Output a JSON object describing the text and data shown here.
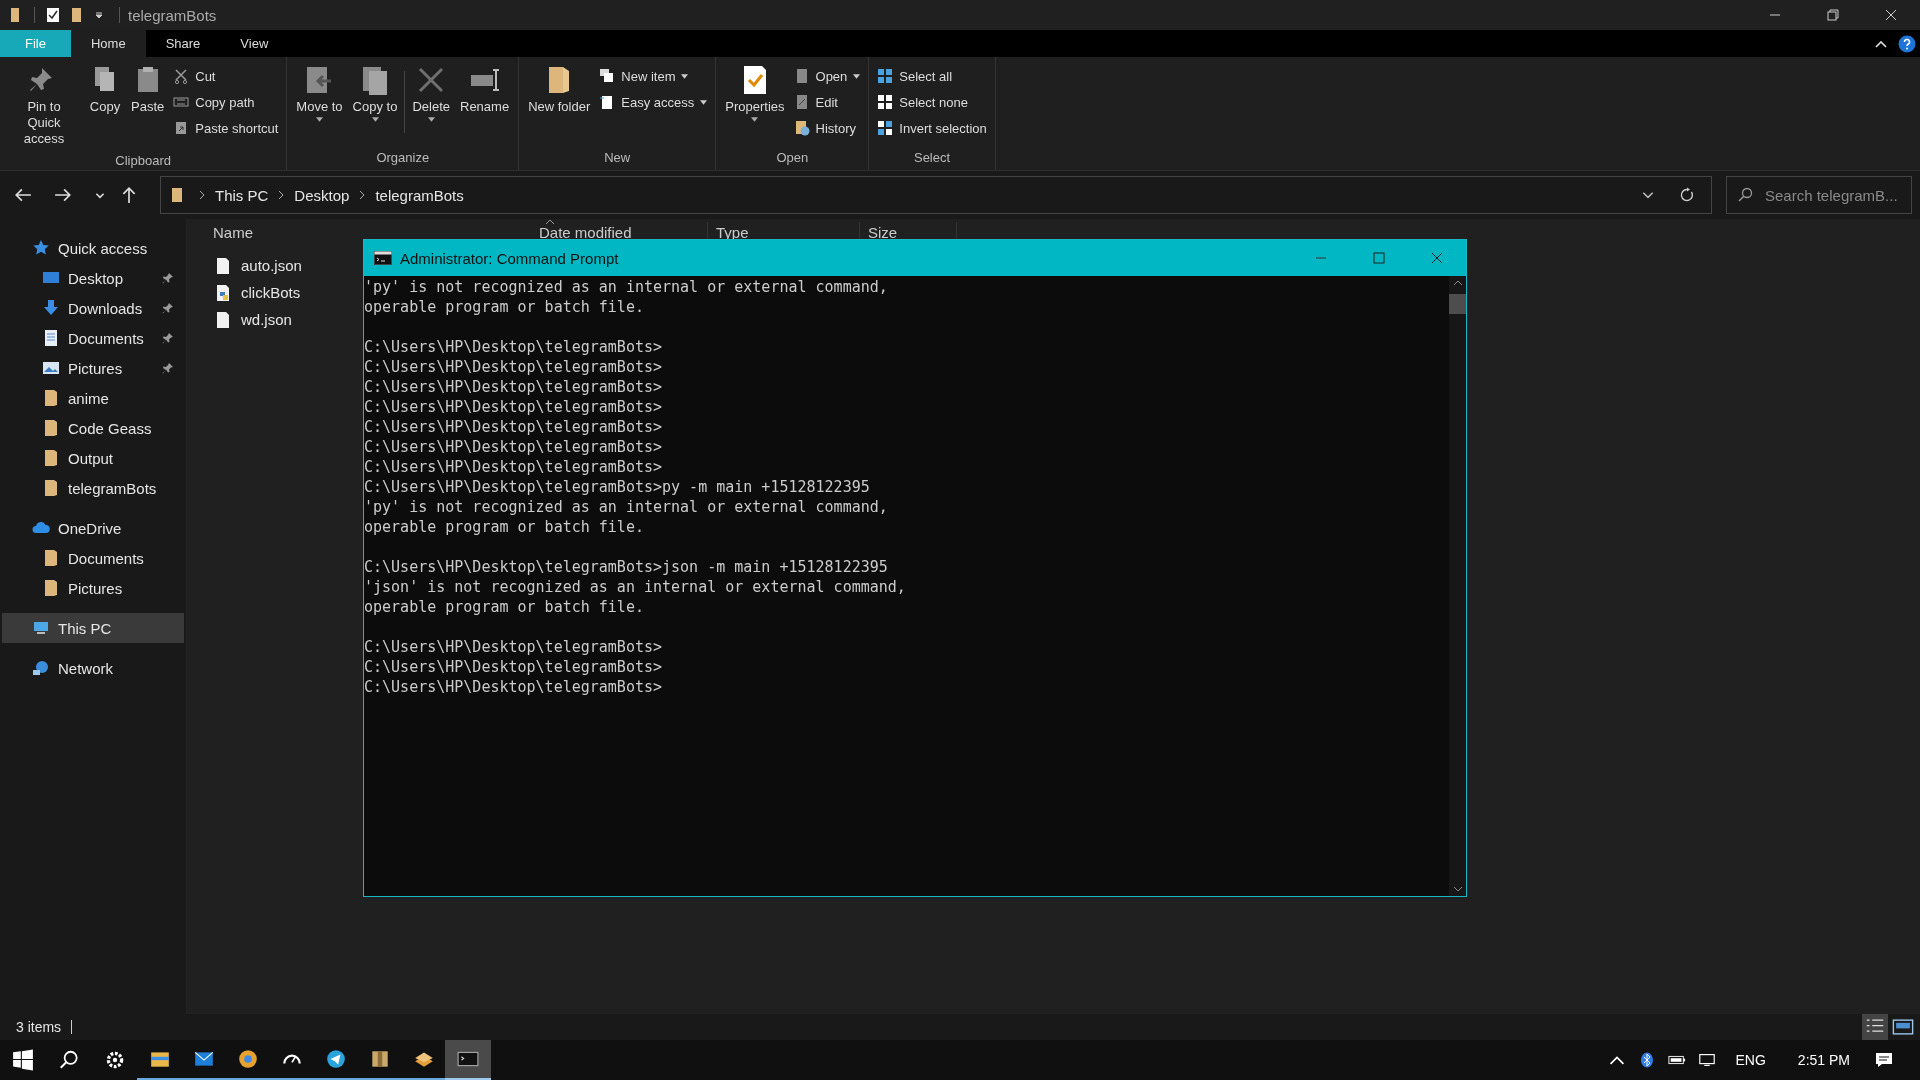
{
  "window": {
    "title": "telegramBots"
  },
  "ribbon": {
    "tabs": [
      {
        "label": "File",
        "selected": false,
        "kind": "file"
      },
      {
        "label": "Home",
        "selected": true,
        "kind": "tab"
      },
      {
        "label": "Share",
        "selected": false,
        "kind": "tab"
      },
      {
        "label": "View",
        "selected": false,
        "kind": "tab"
      }
    ],
    "groups": [
      {
        "label": "Clipboard",
        "items": [
          {
            "label": "Pin to Quick access",
            "kind": "large",
            "dropdown": false
          },
          {
            "label": "Copy",
            "kind": "large",
            "dropdown": false
          },
          {
            "label": "Paste",
            "kind": "large",
            "dropdown": false
          },
          {
            "label": "Cut",
            "kind": "small",
            "dropdown": false
          },
          {
            "label": "Copy path",
            "kind": "small",
            "dropdown": false
          },
          {
            "label": "Paste shortcut",
            "kind": "small",
            "dropdown": false
          }
        ]
      },
      {
        "label": "Organize",
        "items": [
          {
            "label": "Move to",
            "kind": "large",
            "dropdown": true
          },
          {
            "label": "Copy to",
            "kind": "large",
            "dropdown": true
          },
          {
            "label": "Delete",
            "kind": "large",
            "dropdown": true
          },
          {
            "label": "Rename",
            "kind": "large",
            "dropdown": false
          }
        ]
      },
      {
        "label": "New",
        "items": [
          {
            "label": "New folder",
            "kind": "large",
            "dropdown": false
          },
          {
            "label": "New item",
            "kind": "small",
            "dropdown": true
          },
          {
            "label": "Easy access",
            "kind": "small",
            "dropdown": true
          }
        ]
      },
      {
        "label": "Open",
        "items": [
          {
            "label": "Properties",
            "kind": "large",
            "dropdown": true
          },
          {
            "label": "Open",
            "kind": "small",
            "dropdown": true
          },
          {
            "label": "Edit",
            "kind": "small",
            "dropdown": false
          },
          {
            "label": "History",
            "kind": "small",
            "dropdown": false
          }
        ]
      },
      {
        "label": "Select",
        "items": [
          {
            "label": "Select all",
            "kind": "small",
            "dropdown": false
          },
          {
            "label": "Select none",
            "kind": "small",
            "dropdown": false
          },
          {
            "label": "Invert selection",
            "kind": "small",
            "dropdown": false
          }
        ]
      }
    ]
  },
  "address": {
    "path": [
      "This PC",
      "Desktop",
      "telegramBots"
    ],
    "search": {
      "placeholder": "Search telegramB..."
    }
  },
  "navigation": [
    {
      "label": "Quick access",
      "selected": false,
      "children": [
        {
          "label": "Desktop",
          "pinned": true
        },
        {
          "label": "Downloads",
          "pinned": true
        },
        {
          "label": "Documents",
          "pinned": true
        },
        {
          "label": "Pictures",
          "pinned": true
        },
        {
          "label": "anime",
          "pinned": false
        },
        {
          "label": "Code Geass",
          "pinned": false
        },
        {
          "label": "Output",
          "pinned": false
        },
        {
          "label": "telegramBots",
          "pinned": false
        }
      ]
    },
    {
      "label": "OneDrive",
      "selected": false,
      "children": [
        {
          "label": "Documents",
          "pinned": false
        },
        {
          "label": "Pictures",
          "pinned": false
        }
      ]
    },
    {
      "label": "This PC",
      "selected": true
    },
    {
      "label": "Network",
      "selected": false
    }
  ],
  "files": {
    "columns": [
      "Name",
      "Date modified",
      "Type",
      "Size"
    ],
    "items": [
      {
        "name": "auto.json"
      },
      {
        "name": "clickBots"
      },
      {
        "name": "wd.json"
      }
    ]
  },
  "command_prompt": {
    "title": "Administrator: Command Prompt",
    "blocks": [
      [
        "'py' is not recognized as an internal or external command,",
        "operable program or batch file."
      ],
      [
        "C:\\Users\\HP\\Desktop\\telegramBots>",
        "C:\\Users\\HP\\Desktop\\telegramBots>",
        "C:\\Users\\HP\\Desktop\\telegramBots>",
        "C:\\Users\\HP\\Desktop\\telegramBots>",
        "C:\\Users\\HP\\Desktop\\telegramBots>",
        "C:\\Users\\HP\\Desktop\\telegramBots>",
        "C:\\Users\\HP\\Desktop\\telegramBots>",
        "C:\\Users\\HP\\Desktop\\telegramBots>py -m main +15128122395",
        "'py' is not recognized as an internal or external command,",
        "operable program or batch file."
      ],
      [
        "C:\\Users\\HP\\Desktop\\telegramBots>json -m main +15128122395",
        "'json' is not recognized as an internal or external command,",
        "operable program or batch file."
      ],
      [
        "C:\\Users\\HP\\Desktop\\telegramBots>",
        "C:\\Users\\HP\\Desktop\\telegramBots>",
        "C:\\Users\\HP\\Desktop\\telegramBots>"
      ]
    ]
  },
  "status_bar": {
    "count": "3 items"
  },
  "taskbar": {
    "apps": [
      {
        "selected": false
      },
      {
        "selected": false
      },
      {
        "selected": false
      },
      {
        "selected": false
      },
      {
        "selected": false
      },
      {
        "selected": false
      },
      {
        "selected": false
      },
      {
        "selected": true
      }
    ],
    "language": "ENG",
    "time": "2:51 PM"
  }
}
